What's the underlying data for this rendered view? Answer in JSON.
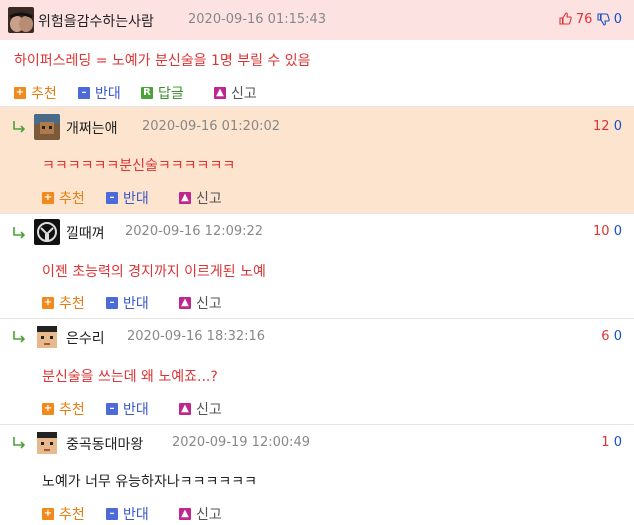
{
  "main": {
    "nickname": "위험을감수하는사람",
    "date": "2020-09-16 01:15:43",
    "up": "76",
    "down": "0",
    "content": "하이퍼스레딩 = 노예가 분신술을 1명 부릴 수 있음",
    "actions": {
      "recommend": "추천",
      "oppose": "반대",
      "reply": "답글",
      "report": "신고"
    }
  },
  "replies": [
    {
      "nickname": "개쩌는애",
      "date": "2020-09-16 01:20:02",
      "up": "12",
      "down": "0",
      "content": "ㅋㅋㅋㅋㅋㅋ분신술ㅋㅋㅋㅋㅋㅋ"
    },
    {
      "nickname": "낄때껴",
      "date": "2020-09-16 12:09:22",
      "up": "10",
      "down": "0",
      "content": "이젠 초능력의 경지까지 이르게된 노예"
    },
    {
      "nickname": "은수리",
      "date": "2020-09-16 18:32:16",
      "up": "6",
      "down": "0",
      "content": "분신술을 쓰는데 왜 노예죠...?"
    },
    {
      "nickname": "중곡동대마왕",
      "date": "2020-09-19 12:00:49",
      "up": "1",
      "down": "0",
      "content": "노예가 너무 유능하자나ㅋㅋㅋㅋㅋㅋ"
    }
  ],
  "reply_actions": {
    "recommend": "추천",
    "oppose": "반대",
    "report": "신고"
  },
  "icons": {
    "thumbs_up": "thumbs-up-icon",
    "thumbs_down": "thumbs-down-icon",
    "reply_arrow": "reply-arrow-icon"
  },
  "colors": {
    "main_header_bg": "#fde2e2",
    "highlight_bg": "#fde4cf",
    "content_red": "#dd3333",
    "upvote": "#dd3333",
    "downvote": "#1a4fc4",
    "recommend": "#f08a1c",
    "oppose": "#4c6ad8",
    "reply": "#4aa23a",
    "report": "#c02690"
  }
}
